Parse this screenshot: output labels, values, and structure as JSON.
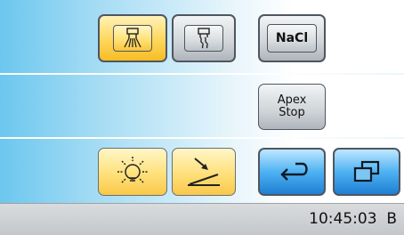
{
  "screen": {
    "buttons": {
      "spray_full": {
        "icon": "spray-full-icon",
        "state": "active"
      },
      "spray_wavy": {
        "icon": "spray-wavy-icon",
        "state": "inactive"
      },
      "nacl": {
        "label": "NaCl"
      },
      "apex_stop": {
        "line1": "Apex",
        "line2": "Stop"
      },
      "light": {
        "icon": "light-bulb-icon",
        "state": "active"
      },
      "slope": {
        "icon": "slope-arrow-icon",
        "state": "active"
      },
      "back": {
        "icon": "return-arrow-icon"
      },
      "windows": {
        "icon": "windows-icon"
      }
    },
    "colors": {
      "active_yellow": "#ffd65a",
      "nav_blue": "#4fb2f2",
      "panel_blue": "#6cc7ef"
    }
  },
  "status_bar": {
    "time": "10:45:03",
    "suffix": "B"
  }
}
